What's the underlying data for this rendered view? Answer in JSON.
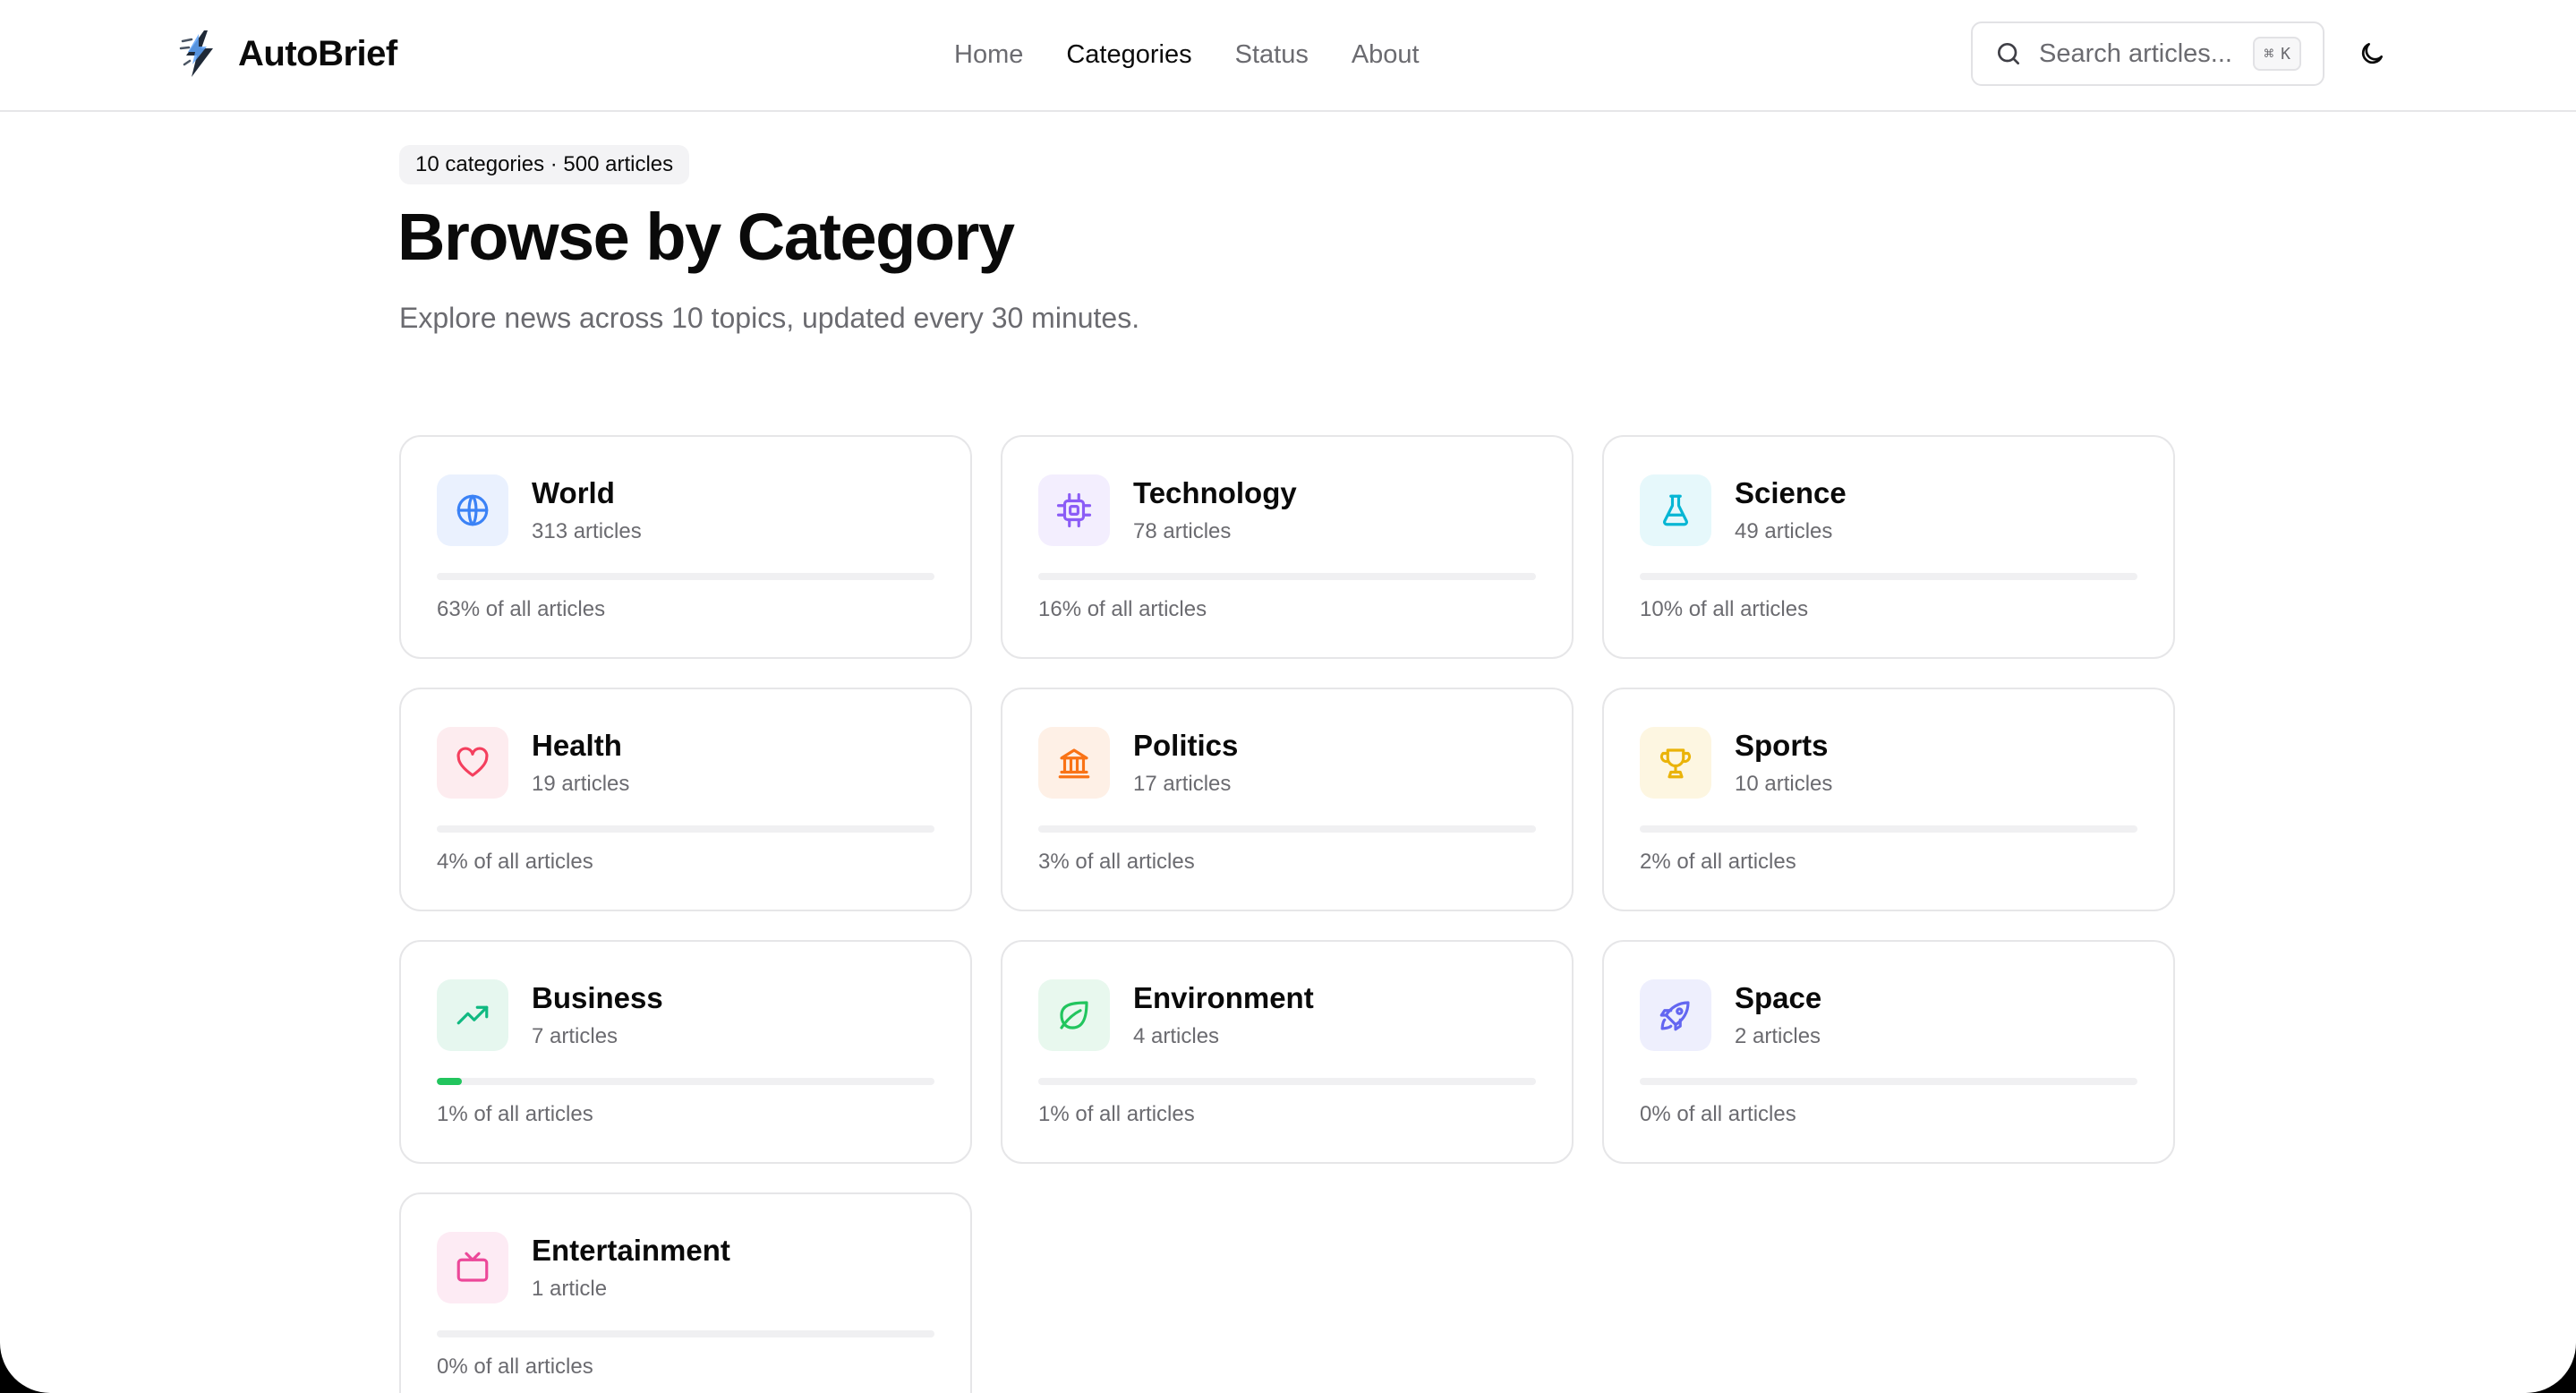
{
  "app": {
    "name": "AutoBrief"
  },
  "nav": [
    {
      "label": "Home",
      "active": false
    },
    {
      "label": "Categories",
      "active": true
    },
    {
      "label": "Status",
      "active": false
    },
    {
      "label": "About",
      "active": false
    }
  ],
  "search": {
    "placeholder": "Search articles...",
    "shortcut_symbol": "⌘",
    "shortcut_key": "K"
  },
  "intro": {
    "badge": "10 categories · 500 articles",
    "title": "Browse by Category",
    "subtitle": "Explore news across 10 topics, updated every 30 minutes."
  },
  "categories": [
    {
      "name": "World",
      "count": "313 articles",
      "percent_label": "63% of all articles",
      "share": 0.0,
      "icon": "globe-icon",
      "color": "#3b82f6",
      "bg": "#eaf1fe"
    },
    {
      "name": "Technology",
      "count": "78 articles",
      "percent_label": "16% of all articles",
      "share": 0.0,
      "icon": "cpu-icon",
      "color": "#8b5cf6",
      "bg": "#f3eefe"
    },
    {
      "name": "Science",
      "count": "49 articles",
      "percent_label": "10% of all articles",
      "share": 0.0,
      "icon": "flask-icon",
      "color": "#06b6d4",
      "bg": "#e6f8fb"
    },
    {
      "name": "Health",
      "count": "19 articles",
      "percent_label": "4% of all articles",
      "share": 0.0,
      "icon": "heart-icon",
      "color": "#f43f5e",
      "bg": "#fdecef"
    },
    {
      "name": "Politics",
      "count": "17 articles",
      "percent_label": "3% of all articles",
      "share": 0.0,
      "icon": "landmark-icon",
      "color": "#f97316",
      "bg": "#fef0e6"
    },
    {
      "name": "Sports",
      "count": "10 articles",
      "percent_label": "2% of all articles",
      "share": 0.0,
      "icon": "trophy-icon",
      "color": "#eab308",
      "bg": "#fdf6e1"
    },
    {
      "name": "Business",
      "count": "7 articles",
      "percent_label": "1% of all articles",
      "share": 0.05,
      "icon": "trending-up-icon",
      "color": "#10b981",
      "bg": "#e6f7ef"
    },
    {
      "name": "Environment",
      "count": "4 articles",
      "percent_label": "1% of all articles",
      "share": 0.0,
      "icon": "leaf-icon",
      "color": "#22c55e",
      "bg": "#e8f8ee"
    },
    {
      "name": "Space",
      "count": "2 articles",
      "percent_label": "0% of all articles",
      "share": 0.0,
      "icon": "rocket-icon",
      "color": "#6366f1",
      "bg": "#eeeffd"
    },
    {
      "name": "Entertainment",
      "count": "1 article",
      "percent_label": "0% of all articles",
      "share": 0.0,
      "icon": "tv-icon",
      "color": "#ec4899",
      "bg": "#fdebf4"
    }
  ]
}
